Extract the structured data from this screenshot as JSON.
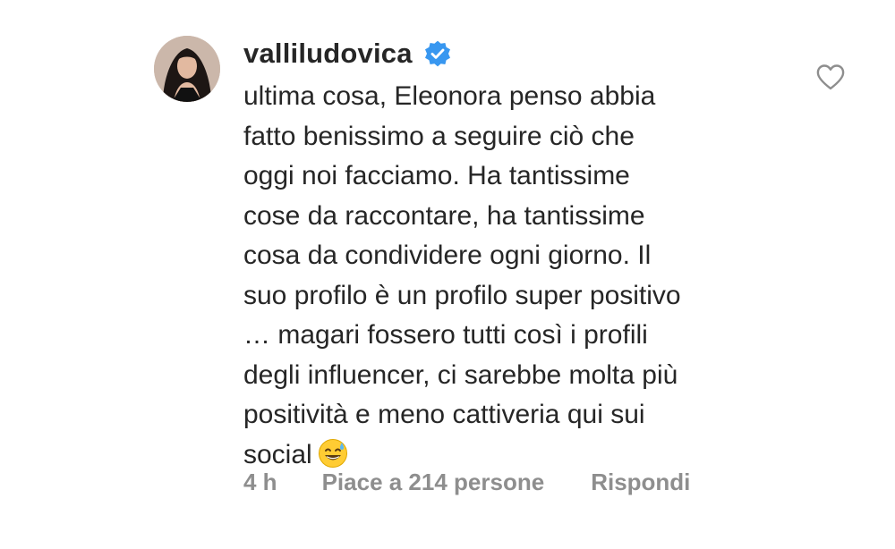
{
  "comment": {
    "username": "valliludovica",
    "verified": true,
    "text": "ultima cosa, Eleonora penso abbia\nfatto benissimo a seguire ciò che\noggi noi facciamo. Ha tantissime\ncose da raccontare, ha tantissime\ncosa da condividere ogni giorno. Il\nsuo profilo è un profilo super positivo\n… magari fossero tutti così i profili\ndegli influencer, ci sarebbe molta più\npositività e meno cattiveria qui sui\nsocial",
    "emoji": "sweat-smile-emoji",
    "time": "4 h",
    "likes_label": "Piace a 214 persone",
    "reply_label": "Rispondi"
  },
  "colors": {
    "text": "#262626",
    "secondary": "#8e8e8e",
    "verified_badge": "#3897f0"
  },
  "icons": {
    "verified": "verified-badge-icon",
    "like": "heart-outline-icon"
  }
}
